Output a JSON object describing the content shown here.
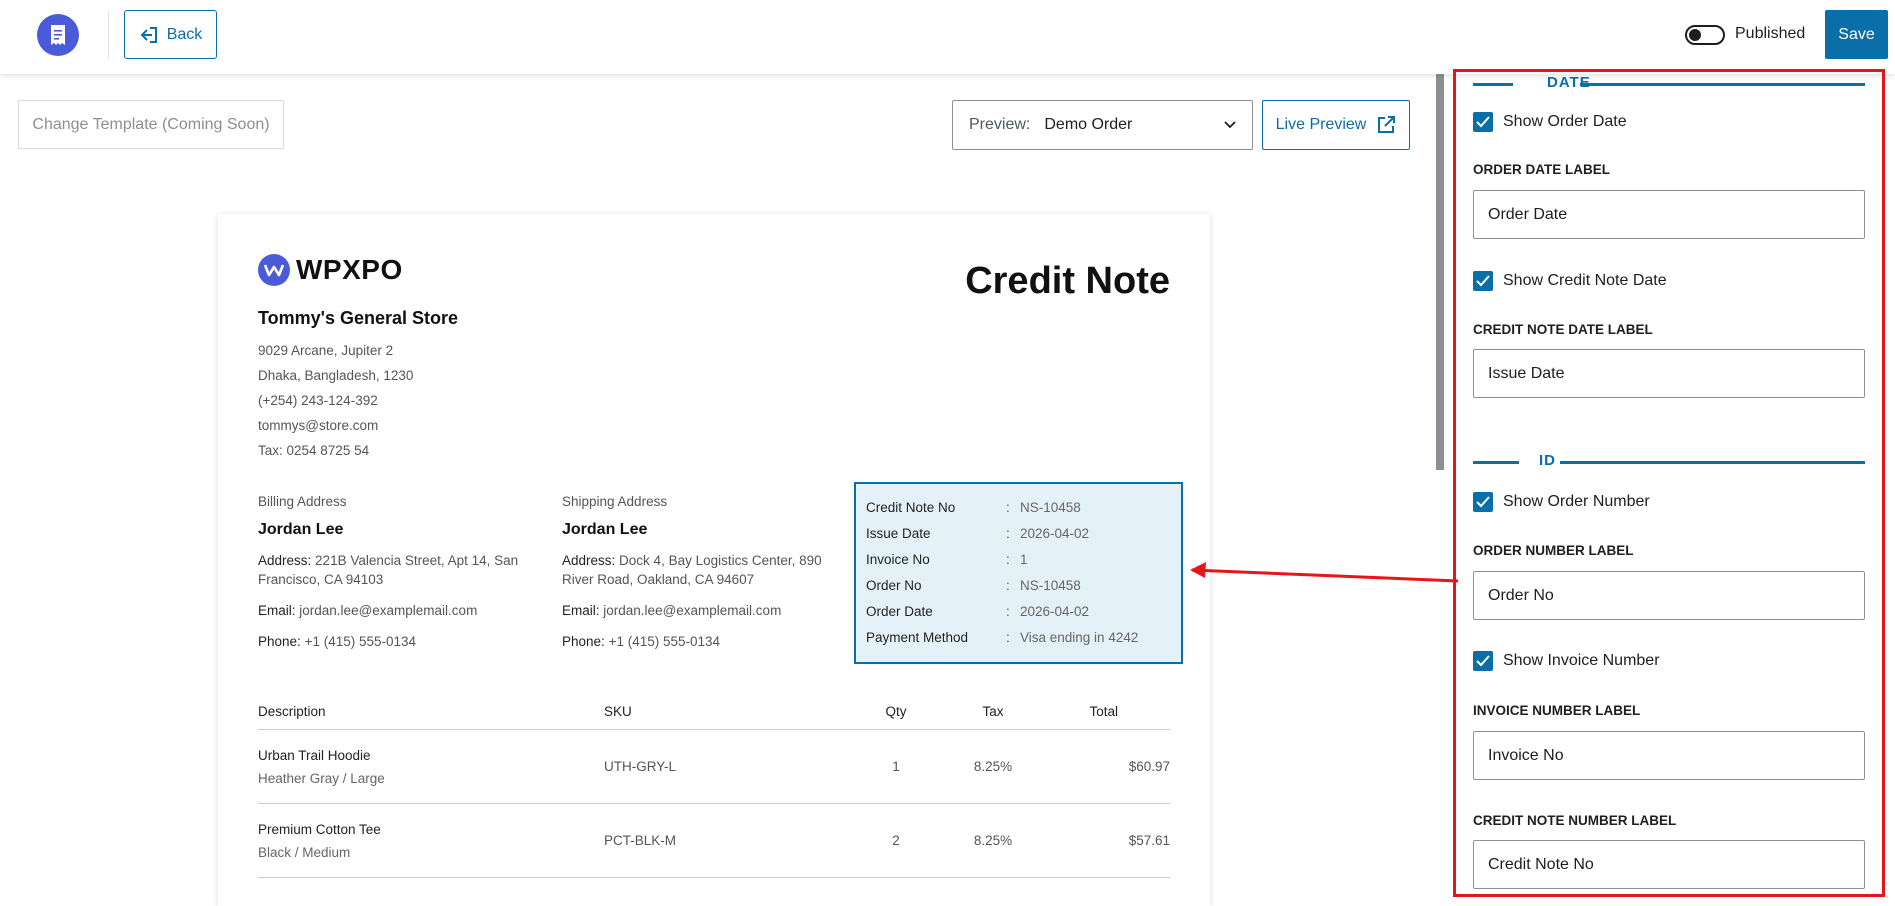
{
  "topbar": {
    "logo_icon": "receipt-icon",
    "back_label": "Back",
    "published_label": "Published",
    "published_on": false,
    "save_label": "Save"
  },
  "toolbar": {
    "change_template_label": "Change Template (Coming Soon)",
    "preview_label": "Preview:",
    "preview_value": "Demo Order",
    "live_preview_label": "Live Preview"
  },
  "document": {
    "brand": "WPXPO",
    "title": "Credit Note",
    "store": {
      "name": "Tommy's General Store",
      "lines": [
        "9029 Arcane, Jupiter 2",
        "Dhaka, Bangladesh, 1230",
        "(+254) 243-124-392",
        "tommys@store.com",
        "Tax: 0254 8725 54"
      ]
    },
    "billing": {
      "heading": "Billing Address",
      "name": "Jordan Lee",
      "address_label": "Address:",
      "address": "221B Valencia Street, Apt 14, San Francisco, CA 94103",
      "email_label": "Email:",
      "email": "jordan.lee@examplemail.com",
      "phone_label": "Phone:",
      "phone": "+1 (415) 555-0134"
    },
    "shipping": {
      "heading": "Shipping Address",
      "name": "Jordan Lee",
      "address_label": "Address:",
      "address": "Dock 4, Bay Logistics Center, 890 River Road, Oakland, CA 94607",
      "email_label": "Email:",
      "email": "jordan.lee@examplemail.com",
      "phone_label": "Phone:",
      "phone": "+1 (415) 555-0134"
    },
    "meta": [
      {
        "key": "Credit Note No",
        "sep": ":",
        "value": "NS-10458"
      },
      {
        "key": "Issue Date",
        "sep": ":",
        "value": "2026-04-02"
      },
      {
        "key": "Invoice No",
        "sep": ":",
        "value": "1"
      },
      {
        "key": "Order No",
        "sep": ":",
        "value": "NS-10458"
      },
      {
        "key": "Order Date",
        "sep": ":",
        "value": "2026-04-02"
      },
      {
        "key": "Payment Method",
        "sep": ":",
        "value": "Visa ending in 4242"
      }
    ],
    "items_header": {
      "description": "Description",
      "sku": "SKU",
      "qty": "Qty",
      "tax": "Tax",
      "total": "Total"
    },
    "items": [
      {
        "name": "Urban Trail Hoodie",
        "variant": "Heather Gray / Large",
        "sku": "UTH-GRY-L",
        "qty": "1",
        "tax": "8.25%",
        "total": "$60.97"
      },
      {
        "name": "Premium Cotton Tee",
        "variant": "Black / Medium",
        "sku": "PCT-BLK-M",
        "qty": "2",
        "tax": "8.25%",
        "total": "$57.61"
      }
    ]
  },
  "panel": {
    "date_section": "DATE",
    "show_order_date": "Show Order Date",
    "order_date_label_title": "ORDER DATE LABEL",
    "order_date_label_value": "Order Date",
    "show_credit_note_date": "Show Credit Note Date",
    "credit_note_date_label_title": "CREDIT NOTE DATE LABEL",
    "credit_note_date_label_value": "Issue Date",
    "id_section": "ID",
    "show_order_number": "Show Order Number",
    "order_number_label_title": "ORDER NUMBER LABEL",
    "order_number_label_value": "Order No",
    "show_invoice_number": "Show Invoice Number",
    "invoice_number_label_title": "INVOICE NUMBER LABEL",
    "invoice_number_label_value": "Invoice No",
    "credit_note_number_label_title": "CREDIT NOTE NUMBER LABEL",
    "credit_note_number_label_value": "Credit Note No"
  },
  "colors": {
    "accent": "#0a6ea8",
    "highlight": "#e8141b",
    "brand": "#4a5bd9",
    "meta_bg": "#e5f1f8"
  }
}
